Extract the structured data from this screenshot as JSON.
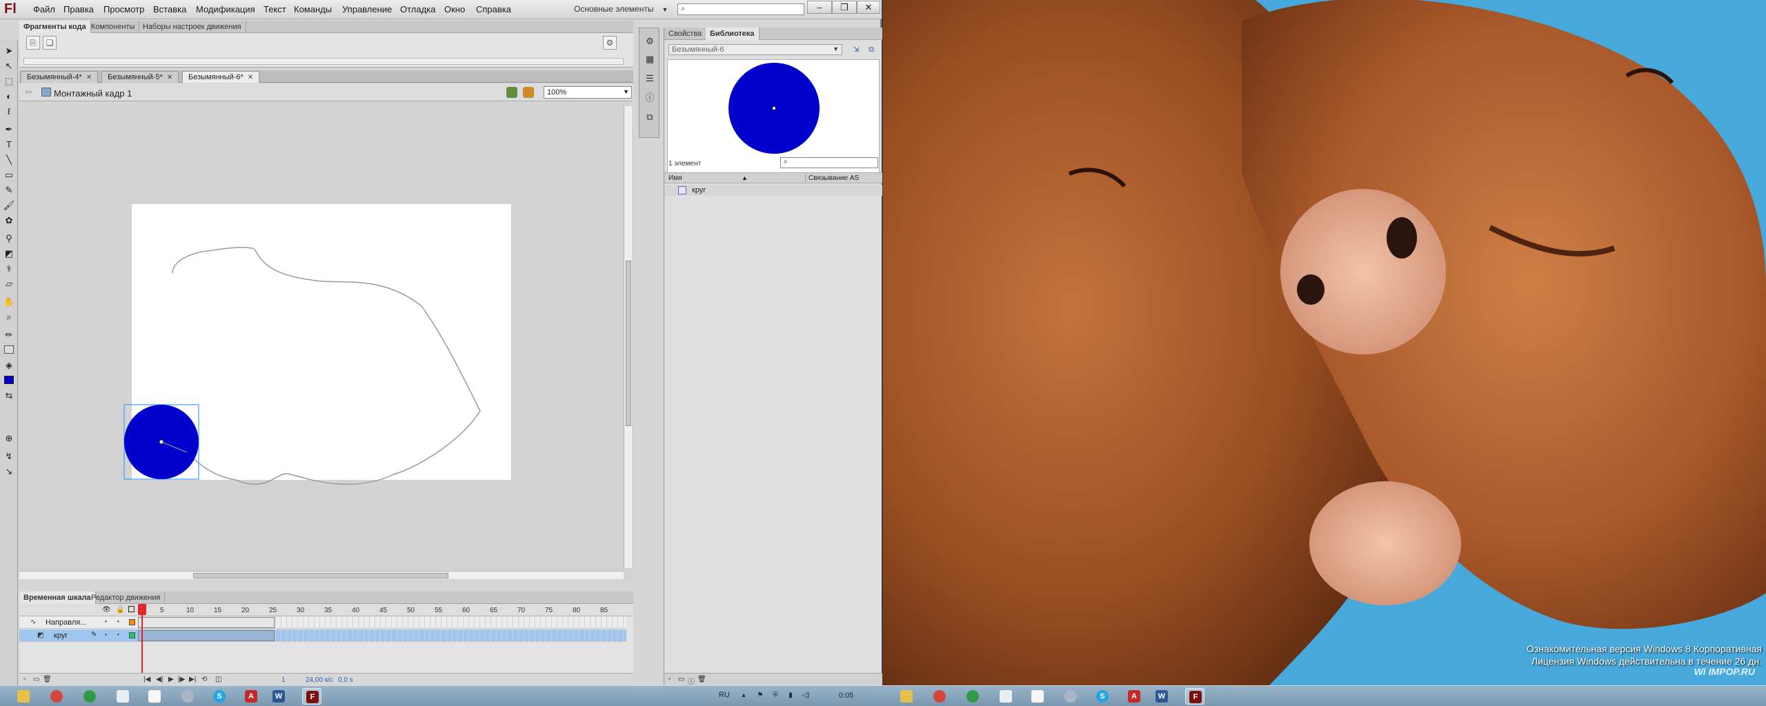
{
  "app": {
    "logo": "Fl",
    "menu": [
      "Файл",
      "Правка",
      "Просмотр",
      "Вставка",
      "Модификация",
      "Текст",
      "Команды",
      "Управление",
      "Отладка",
      "Окно",
      "Справка"
    ],
    "workspace": "Основные элементы",
    "window_buttons": [
      "–",
      "❐",
      "✕"
    ]
  },
  "snippets_panel": {
    "tabs": [
      "Фрагменты кода",
      "Компоненты",
      "Наборы настроек движения"
    ],
    "active_tab": 0
  },
  "documents": {
    "tabs": [
      "Безымянный-4*",
      "Безымянный-5*",
      "Безымянный-6*"
    ],
    "active_tab": 2
  },
  "edit_bar": {
    "scene": "Монтажный кадр 1",
    "zoom": "100%"
  },
  "stage": {
    "background": "#ffffff",
    "circle_color": "#0000cc",
    "selection_color": "#3aa0ff",
    "path_color": "#9a9a9a"
  },
  "timeline": {
    "tabs": [
      "Временная шкала",
      "Редактор движения"
    ],
    "frame_numbers": [
      "5",
      "10",
      "15",
      "20",
      "25",
      "30",
      "35",
      "40",
      "45",
      "50",
      "55",
      "60",
      "65",
      "70",
      "75",
      "80",
      "85"
    ],
    "current_frame_marker": "1",
    "layers": [
      {
        "name": "Направля...",
        "selected": false,
        "color": "#ff8c00"
      },
      {
        "name": "круг",
        "selected": true,
        "color": "#22c55e"
      }
    ],
    "current_frame": "1",
    "fps": "24,00 к/с",
    "time": "0,0 s"
  },
  "library": {
    "tabs": [
      "Свойства",
      "Библиотека"
    ],
    "active_tab": 1,
    "document": "Безымянный-6",
    "count": "1 элемент",
    "columns": [
      "Имя",
      "Связывание AS"
    ],
    "items": [
      {
        "name": "круг",
        "type": "graphic"
      }
    ]
  },
  "desktop": {
    "watermark_line1": "Ознакомительная версия Windows 8 Корпоративная",
    "watermark_line2": "Лицензия Windows действительна в течение 26 дн.",
    "wallpaper_logo": "Wi IMPOP.RU"
  },
  "taskbar": {
    "language": "RU",
    "clock": "0:05"
  }
}
